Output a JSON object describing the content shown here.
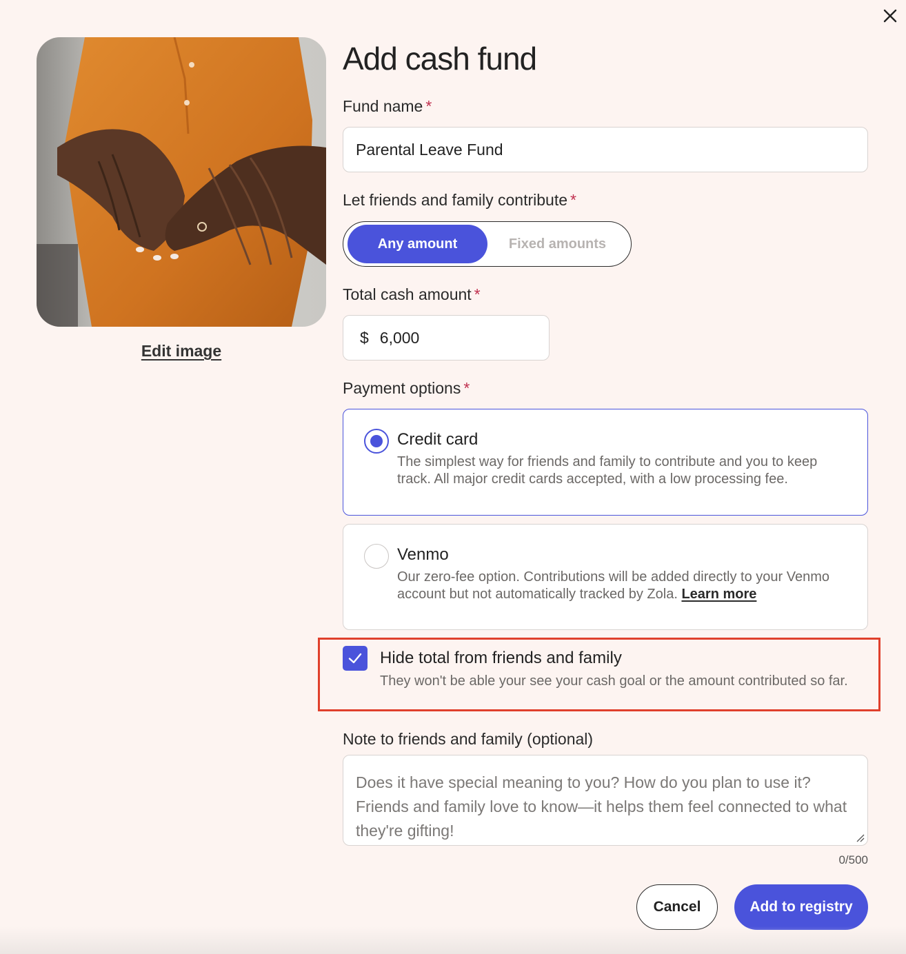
{
  "modal": {
    "title": "Add cash fund",
    "close_icon": "close-icon"
  },
  "image": {
    "edit_label": "Edit image",
    "colors": {
      "dress": "#d77a24",
      "skin": "#5b3826",
      "background": "#c8c7c3"
    }
  },
  "fund_name": {
    "label": "Fund name",
    "required_mark": "*",
    "value": "Parental Leave Fund"
  },
  "contribute": {
    "label": "Let friends and family contribute",
    "required_mark": "*",
    "options": [
      "Any amount",
      "Fixed amounts"
    ],
    "selected": "Any amount"
  },
  "total": {
    "label": "Total cash amount",
    "required_mark": "*",
    "currency": "$",
    "value": "6,000"
  },
  "payment": {
    "label": "Payment options",
    "required_mark": "*",
    "options": [
      {
        "title": "Credit card",
        "description": "The simplest way for friends and family to contribute and you to keep track. All major credit cards accepted, with a low processing fee.",
        "selected": true
      },
      {
        "title": "Venmo",
        "description": "Our zero-fee option. Contributions will be added directly to your Venmo account but not automatically tracked by Zola.",
        "link": "Learn more",
        "selected": false
      }
    ]
  },
  "hide_total": {
    "checked": true,
    "title": "Hide total from friends and family",
    "description": "They won't be able your see your cash goal or the amount contributed so far."
  },
  "note": {
    "label": "Note to friends and family (optional)",
    "placeholder": "Does it have special meaning to you? How do you plan to use it? Friends and family love to know—it helps them feel connected to what they're gifting!",
    "counter": "0/500"
  },
  "actions": {
    "cancel": "Cancel",
    "submit": "Add to registry"
  },
  "colors": {
    "accent": "#4a53db",
    "background": "#fdf4f1",
    "required": "#c0304f",
    "highlight": "#e0402c"
  }
}
